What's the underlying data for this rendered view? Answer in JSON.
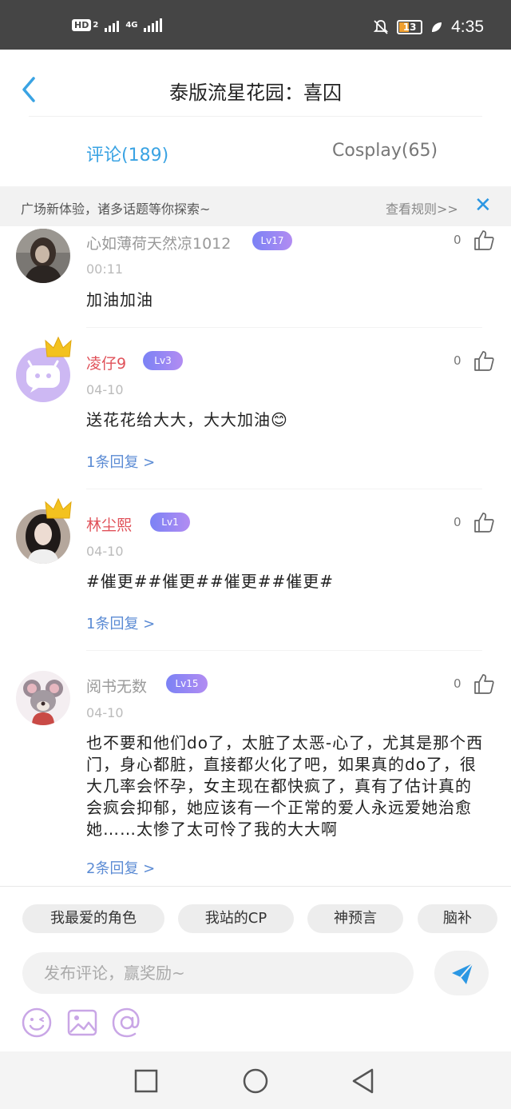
{
  "status_bar": {
    "hd_label": "HD",
    "sim_index": "2",
    "network_type": "4G",
    "battery_level": "13",
    "time": "4:35"
  },
  "header": {
    "title": "泰版流星花园：喜囚"
  },
  "tabs": [
    {
      "label": "评论(189)",
      "active": true
    },
    {
      "label": "Cosplay(65)",
      "active": false
    }
  ],
  "notice": {
    "text": "广场新体验，诸多话题等你探索~",
    "rules_link": "查看规则>>",
    "close_icon": "close-icon"
  },
  "comments": [
    {
      "username": "心如薄荷天然凉1012",
      "level": "Lv17",
      "date": "00:11",
      "text": "加油加油",
      "replies": "",
      "likes": "0",
      "name_color": "gray",
      "crown": false
    },
    {
      "username": "凌仔9",
      "level": "Lv3",
      "date": "04-10",
      "text": "送花花给大大，大大加油😊",
      "replies": "1条回复 >",
      "likes": "0",
      "name_color": "red",
      "crown": true
    },
    {
      "username": "林尘熙",
      "level": "Lv1",
      "date": "04-10",
      "text": "#催更##催更##催更##催更#",
      "replies": "1条回复 >",
      "likes": "0",
      "name_color": "red",
      "crown": true
    },
    {
      "username": "阅书无数",
      "level": "Lv15",
      "date": "04-10",
      "text": "也不要和他们do了，太脏了太恶-心了，尤其是那个西门，身心都脏，直接都火化了吧，如果真的do了，很大几率会怀孕，女主现在都快疯了，真有了估计真的会疯会抑郁，她应该有一个正常的爱人永远爱她治愈她……太惨了太可怜了我的大大啊",
      "replies": "2条回复 >",
      "likes": "0",
      "name_color": "gray",
      "crown": false
    }
  ],
  "topic_chips": [
    "我最爱的角色",
    "我站的CP",
    "神预言",
    "脑补"
  ],
  "composer": {
    "placeholder": "发布评论，赢奖励~"
  },
  "colors": {
    "accent": "#3aa3e3",
    "username_red": "#e0525a",
    "reply_link": "#5b8bd4",
    "level_badge": "#8f86f3"
  }
}
